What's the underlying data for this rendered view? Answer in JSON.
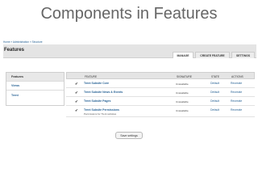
{
  "slide_title": "Components in Features",
  "breadcrumb": "Home » Administration » Structure",
  "page_title": "Features",
  "tabs": [
    {
      "label": "MANAGE",
      "active": true
    },
    {
      "label": "CREATE FEATURE",
      "active": false
    },
    {
      "label": "SETTINGS",
      "active": false
    }
  ],
  "sidebar": {
    "items": [
      {
        "label": "Features",
        "active": true
      },
      {
        "label": "Views",
        "active": false
      },
      {
        "label": "Trent",
        "active": false
      }
    ]
  },
  "table": {
    "headers": {
      "feature": "FEATURE",
      "signature": "SIGNATURE",
      "state": "STATE",
      "actions": "ACTIONS"
    },
    "rows": [
      {
        "name": "Trent Subsite Core",
        "description": "",
        "signature": "Unavailable",
        "state": "Default",
        "action": "Recreate"
      },
      {
        "name": "Trent Subsite News & Events",
        "description": "",
        "signature": "Unavailable",
        "state": "Default",
        "action": "Recreate"
      },
      {
        "name": "Trent Subsite Pages",
        "description": "",
        "signature": "Unavailable",
        "state": "Default",
        "action": "Recreate"
      },
      {
        "name": "Trent Subsite Permissions",
        "description": "Permissions for Trent subsites",
        "signature": "Unavailable",
        "state": "Default",
        "action": "Recreate"
      }
    ]
  },
  "save_button": "Save settings",
  "colors": {
    "link": "#2a6496",
    "header_bg": "#e4e4e4"
  }
}
